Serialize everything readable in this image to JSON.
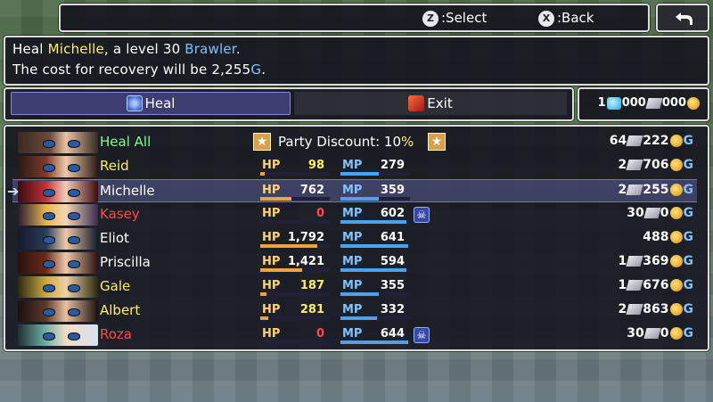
{
  "controls": {
    "select_button": "Z",
    "select_label": ":Select",
    "back_button": "X",
    "back_label": ":Back",
    "return_icon": "return-arrow-icon"
  },
  "help": {
    "line1_prefix": "Heal ",
    "line1_name": "Michelle",
    "line1_mid": ", a level 30 ",
    "line1_class": "Brawler",
    "line1_end": ".",
    "line2_prefix": "The cost for recovery will be 2,255",
    "line2_unit": "G",
    "line2_end": "."
  },
  "commands": [
    {
      "label": "Heal",
      "icon": "heal-icon",
      "selected": true
    },
    {
      "label": "Exit",
      "icon": "exit-icon",
      "selected": false
    }
  ],
  "currency": {
    "gems": "1",
    "gems_after": "000",
    "crystals_after": "000",
    "gold_unit": ""
  },
  "heal_all": {
    "label": "Heal All",
    "discount_text": "Party Discount: 10",
    "discount_pct": "%",
    "cost_crystals": "64",
    "cost_mid": "222",
    "cost_unit": "G"
  },
  "labels": {
    "hp": "HP",
    "mp": "MP",
    "gold": "G"
  },
  "party": [
    {
      "name": "Reid",
      "name_color": "#ffef61",
      "hp": "98",
      "hp_color": "#ffef61",
      "hp_fill": 0.06,
      "mp": "279",
      "mp_fill": 0.55,
      "state_icon": "",
      "cost_a": "2",
      "cost_b": "706",
      "selected": false
    },
    {
      "name": "Michelle",
      "name_color": "#ffffff",
      "hp": "762",
      "hp_color": "#ffffff",
      "hp_fill": 0.45,
      "mp": "359",
      "mp_fill": 0.55,
      "state_icon": "",
      "cost_a": "2",
      "cost_b": "255",
      "selected": true
    },
    {
      "name": "Kasey",
      "name_color": "#ff4a4a",
      "hp": "0",
      "hp_color": "#ff4a4a",
      "hp_fill": 0.0,
      "mp": "602",
      "mp_fill": 0.95,
      "state_icon": "skull-icon",
      "cost_a": "30",
      "cost_b": "0",
      "selected": false
    },
    {
      "name": "Eliot",
      "name_color": "#ffffff",
      "hp": "1,792",
      "hp_color": "#ffffff",
      "hp_fill": 0.82,
      "mp": "641",
      "mp_fill": 0.97,
      "state_icon": "",
      "cost_a": "",
      "cost_b": "488",
      "selected": false
    },
    {
      "name": "Priscilla",
      "name_color": "#ffffff",
      "hp": "1,421",
      "hp_color": "#ffffff",
      "hp_fill": 0.6,
      "mp": "594",
      "mp_fill": 0.95,
      "state_icon": "",
      "cost_a": "1",
      "cost_b": "369",
      "selected": false
    },
    {
      "name": "Gale",
      "name_color": "#ffef61",
      "hp": "187",
      "hp_color": "#ffef61",
      "hp_fill": 0.09,
      "mp": "355",
      "mp_fill": 0.55,
      "state_icon": "",
      "cost_a": "1",
      "cost_b": "676",
      "selected": false
    },
    {
      "name": "Albert",
      "name_color": "#ffef61",
      "hp": "281",
      "hp_color": "#ffef61",
      "hp_fill": 0.12,
      "mp": "332",
      "mp_fill": 0.52,
      "state_icon": "",
      "cost_a": "2",
      "cost_b": "863",
      "selected": false
    },
    {
      "name": "Roza",
      "name_color": "#ff4a4a",
      "hp": "0",
      "hp_color": "#ff4a4a",
      "hp_fill": 0.0,
      "mp": "644",
      "mp_fill": 0.97,
      "state_icon": "skull-icon",
      "cost_a": "30",
      "cost_b": "0",
      "selected": false
    }
  ],
  "colors": {
    "hp_gauge": "#f2a23a",
    "mp_gauge": "#4aa2f2",
    "heal_all_text": "#7dff8f",
    "selected_row": "#5a5ab4"
  }
}
